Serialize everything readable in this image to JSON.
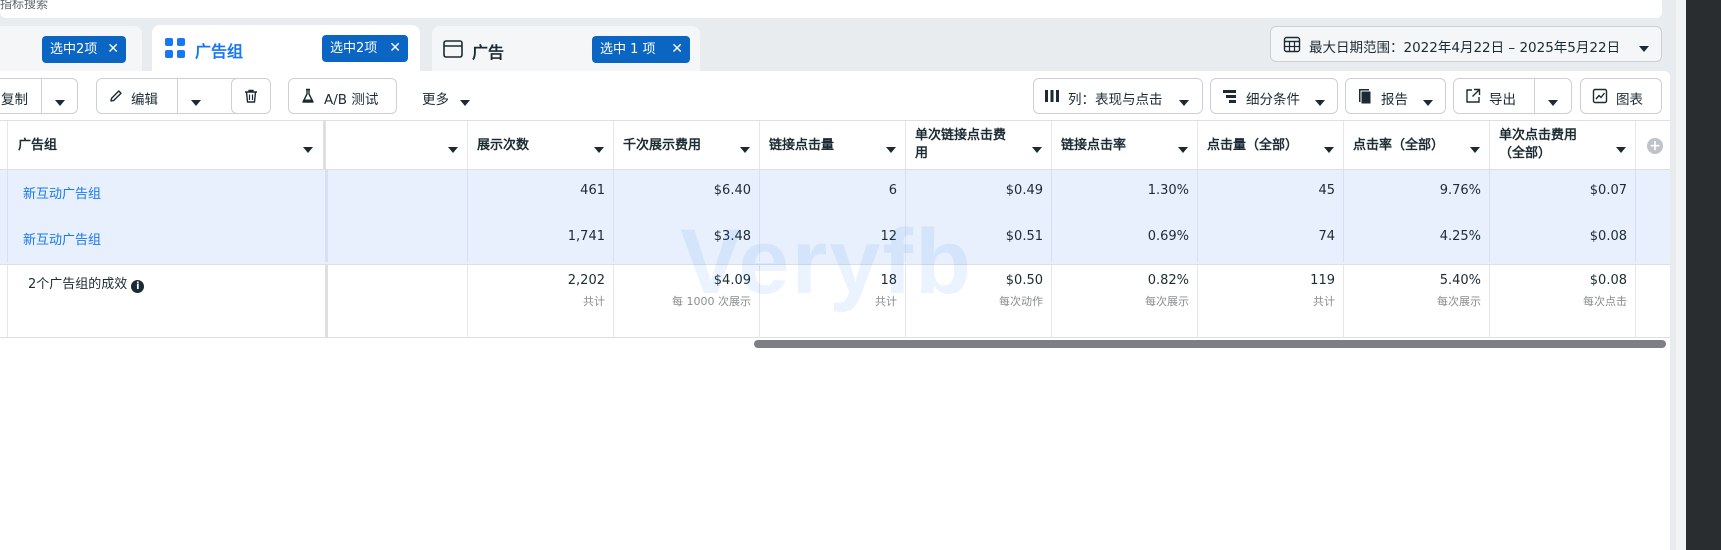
{
  "search": {
    "placeholder_fragment": "指标搜索"
  },
  "tabs": [
    {
      "label": "",
      "badge": "选中2项"
    },
    {
      "label": "广告组",
      "badge": "选中2项",
      "active": true,
      "icon": "grid-icon"
    },
    {
      "label": "广告",
      "badge": "选中 1 项",
      "icon": "ad-window-icon"
    }
  ],
  "date_range": {
    "label": "最大日期范围：2022年4月22日 – 2025年5月22日"
  },
  "toolbar": {
    "copy_label": "复制",
    "edit_label": "编辑",
    "ab_test_label": "A/B 测试",
    "more_label": "更多",
    "columns_label": "列：表现与点击",
    "breakdown_label": "细分条件",
    "report_label": "报告",
    "export_label": "导出",
    "chart_label": "图表"
  },
  "table": {
    "headers": {
      "adset": "广告组",
      "blank": "",
      "impressions": "展示次数",
      "cpm": "千次展示费用",
      "link_clicks": "链接点击量",
      "cpc_link_1": "单次链接点击费",
      "cpc_link_2": "用",
      "ctr_link": "链接点击率",
      "clicks_all": "点击量（全部）",
      "ctr_all": "点击率（全部）",
      "cpc_all_1": "单次点击费用",
      "cpc_all_2": "（全部）"
    },
    "rows": [
      {
        "name": "新互动广告组",
        "impressions": "461",
        "cpm": "$6.40",
        "link_clicks": "6",
        "cpc_link": "$0.49",
        "ctr_link": "1.30%",
        "clicks_all": "45",
        "ctr_all": "9.76%",
        "cpc_all": "$0.07"
      },
      {
        "name": "新互动广告组",
        "impressions": "1,741",
        "cpm": "$3.48",
        "link_clicks": "12",
        "cpc_link": "$0.51",
        "ctr_link": "0.69%",
        "clicks_all": "74",
        "ctr_all": "4.25%",
        "cpc_all": "$0.08"
      }
    ],
    "totals": {
      "label": "2个广告组的成效",
      "impressions": "2,202",
      "impressions_sub": "共计",
      "cpm": "$4.09",
      "cpm_sub": "每 1000 次展示",
      "link_clicks": "18",
      "link_clicks_sub": "共计",
      "cpc_link": "$0.50",
      "cpc_link_sub": "每次动作",
      "ctr_link": "0.82%",
      "ctr_link_sub": "每次展示",
      "clicks_all": "119",
      "clicks_all_sub": "共计",
      "ctr_all": "5.40%",
      "ctr_all_sub": "每次展示",
      "cpc_all": "$0.08",
      "cpc_all_sub": "每次点击"
    }
  },
  "watermark": "Veryfb",
  "colors": {
    "accent": "#1877f2",
    "badge": "#0a66c2",
    "row_selected": "#e7f0fc"
  }
}
